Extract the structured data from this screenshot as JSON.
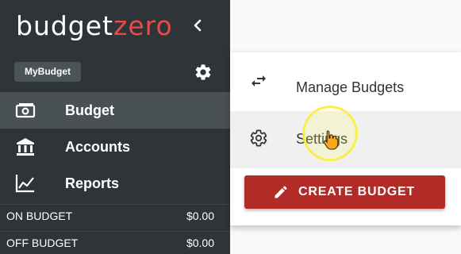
{
  "sidebar": {
    "brand_part1": "budget",
    "brand_part2": "zero",
    "brand_accent_color": "#e94b4b",
    "collapse_icon": "chevron-left-icon",
    "budget_name": "MyBudget",
    "settings_icon": "gear-icon",
    "nav": [
      {
        "label": "Budget",
        "icon": "budget-money-icon",
        "active": true
      },
      {
        "label": "Accounts",
        "icon": "bank-icon",
        "active": false
      },
      {
        "label": "Reports",
        "icon": "line-chart-icon",
        "active": false
      }
    ],
    "summaries": [
      {
        "label": "ON BUDGET",
        "value": "$0.00"
      },
      {
        "label": "OFF BUDGET",
        "value": "$0.00"
      }
    ]
  },
  "menu": {
    "items": [
      {
        "label": "Manage Budgets",
        "icon": "swap-arrows-icon"
      },
      {
        "label": "Settings",
        "icon": "gear-icon"
      }
    ],
    "create_button": {
      "label": "CREATE BUDGET",
      "icon": "pencil-icon",
      "color": "#b32b27"
    }
  }
}
